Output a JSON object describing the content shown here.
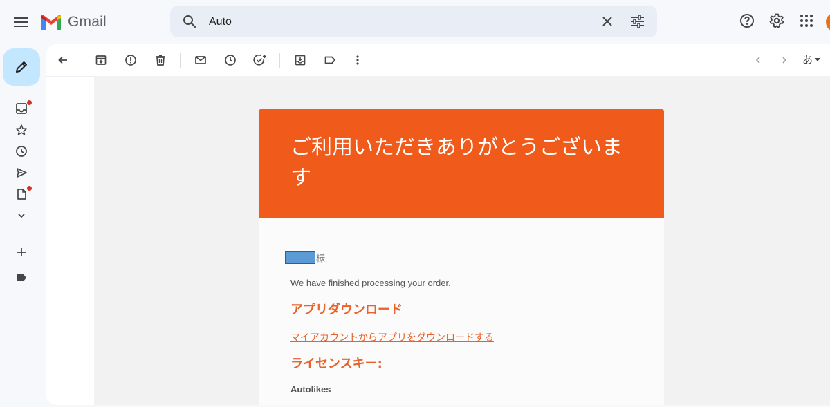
{
  "app": {
    "name": "Gmail"
  },
  "search": {
    "value": "Auto"
  },
  "toolbar": {
    "lang_label": "あ"
  },
  "email": {
    "header_title": "ご利用いただきありがとうございます",
    "greeting_suffix": "様",
    "message": "We have finished processing your order.",
    "download_heading": "アプリダウンロード",
    "download_link": "マイアカウントからアプリをダウンロードする",
    "license_heading": "ライセンスキー:",
    "product_name": "Autolikes"
  },
  "colors": {
    "header_orange": "#f05b1b",
    "accent_orange": "#e8622a",
    "compose_blue": "#c2e7ff",
    "search_bg": "#e9eef6",
    "notification_red": "#d93025"
  },
  "icons": {
    "topbar": [
      "menu-icon",
      "gmail-logo-icon",
      "search-icon",
      "close-icon",
      "tune-icon",
      "help-icon",
      "settings-icon",
      "apps-icon"
    ],
    "rail": [
      "pencil-icon",
      "inbox-icon",
      "star-icon",
      "clock-icon",
      "send-icon",
      "draft-icon",
      "chevron-down-icon",
      "plus-icon",
      "label-icon"
    ],
    "toolbar": [
      "back-arrow-icon",
      "archive-icon",
      "report-spam-icon",
      "delete-icon",
      "mark-unread-icon",
      "snooze-icon",
      "add-task-icon",
      "move-to-icon",
      "label-icon",
      "more-vert-icon",
      "chevron-left-icon",
      "chevron-right-icon"
    ]
  }
}
